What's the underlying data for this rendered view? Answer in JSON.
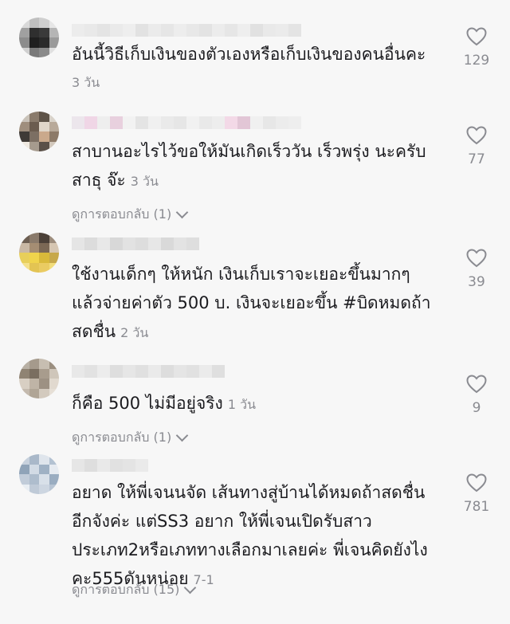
{
  "comments": [
    {
      "text": "อันนี้วิธีเก็บเงินของตัวเองหรือเก็บเงินของคนอื่นคะ",
      "time": "3 วัน",
      "likes": "129",
      "avatar_colors": [
        "#d9d9d9",
        "#bfbfbf",
        "#cfcfcf",
        "#e6e6e6",
        "#a0a0a0",
        "#2f2f2f",
        "#3a3a3a",
        "#b5b5b5",
        "#8c8c8c",
        "#1f1f1f",
        "#2a2a2a",
        "#9a9a9a",
        "#d0d0d0",
        "#7a7a7a",
        "#8a8a8a",
        "#e0e0e0"
      ],
      "username_colors": [
        "#ececec",
        "#e9e9e9",
        "#e4e4e4",
        "#eaeaea",
        "#eeeeee",
        "#e2e2e2",
        "#ebebeb",
        "#e6e6e6",
        "#ededed",
        "#e8e8e8",
        "#e3e3e3",
        "#ececec",
        "#e6e6e6",
        "#eeeeee",
        "#e1e1e1",
        "#e9e9e9",
        "#ebebeb",
        "#e4e4e4"
      ]
    },
    {
      "text": "สาบานอะไรไว้ขอให้มันเกิดเร็ววัน เร็วพรุ่ง นะครับ\nสาธุ จ๊ะ",
      "time": "3 วัน",
      "likes": "77",
      "replies_label": "ดูการตอบกลับ (1)",
      "avatar_colors": [
        "#c9c2b8",
        "#8a7b6c",
        "#5e5348",
        "#d8d2c9",
        "#9f8e7d",
        "#6b5c4f",
        "#e0d6c9",
        "#b8a999",
        "#3f3a36",
        "#7c6f63",
        "#caa98c",
        "#8d7a68",
        "#efe9e1",
        "#a69b8e",
        "#5a5048",
        "#d2c8bc"
      ],
      "username_colors": [
        "#ece6ec",
        "#f0d6e6",
        "#eeeeee",
        "#e8d0de",
        "#f2f2f2",
        "#e4e4e4",
        "#f0f0f0",
        "#eaeaea",
        "#e6e6e6",
        "#f1f1f1",
        "#e9e9e9",
        "#ededed",
        "#f3d9e7",
        "#e2c6d6",
        "#f0f0f0",
        "#e7e7e7",
        "#ececec",
        "#eeeeee"
      ]
    },
    {
      "text": "ใช้งานเด็กๆ ให้หนัก เงินเก็บเราจะเยอะขึ้นมากๆ\nแล้วจ่ายค่าตัว 500 บ. เงินจะเยอะขึ้น #บิดหมดถ้า\nสดชื่น",
      "time": "2 วัน",
      "likes": "39",
      "avatar_colors": [
        "#6d5f52",
        "#8a7a6b",
        "#4b4038",
        "#9c8c7c",
        "#c9b8a4",
        "#a58d73",
        "#7b6855",
        "#d6c6b2",
        "#e8cf5a",
        "#f0d44c",
        "#d9b93a",
        "#c7a84a",
        "#f4e08a",
        "#e3c453",
        "#eacb62",
        "#f2dd7a"
      ],
      "username_colors": [
        "#e5e5e5",
        "#dcdcdc",
        "#e8e8e8",
        "#d8d8d8",
        "#e2e2e2",
        "#dddddd",
        "#e7e7e7",
        "#d9d9d9",
        "#e3e3e3",
        "#dedede"
      ]
    },
    {
      "text": "ก็คือ 500 ไม่มีอยู่จริง",
      "time": "1 วัน",
      "likes": "9",
      "replies_label": "ดูการตอบกลับ (1)",
      "avatar_colors": [
        "#b8b0a4",
        "#a59a8c",
        "#c7beb1",
        "#9b8f80",
        "#8f8373",
        "#7a6e60",
        "#a89c8d",
        "#cfc6ba",
        "#d8cfc3",
        "#bfb4a6",
        "#9d9183",
        "#e1d9cf",
        "#c4baae",
        "#b0a596",
        "#d3cabe",
        "#e6dfd6"
      ],
      "username_colors": [
        "#e8e8e8",
        "#e2e2e2",
        "#ececec",
        "#dedede",
        "#e6e6e6",
        "#e0e0e0",
        "#eaeaea",
        "#dddddd",
        "#e5e5e5",
        "#e1e1e1",
        "#ebebeb",
        "#dfdfdf"
      ]
    },
    {
      "text": "อยาด ให้พี่เจนนจัด เส้นทางสู่บ้านได้หมดถ้าสดชื่น\nอีกจังค่ะ แต่SS3 อยาก ให้พี่เจนเปิดรับสาว\nประเภท2หรือเภททางเลือกมาเลยค่ะ พี่เจนคิดยังไง\nคะ555ดันหน่อย",
      "time": "7-1",
      "likes": "781",
      "replies_label": "ดูการตอบกลับ (15)",
      "avatar_colors": [
        "#c7d1dd",
        "#a9b8c9",
        "#dfe5ec",
        "#b3c2d2",
        "#8fa3b8",
        "#d2dbe5",
        "#9fb1c4",
        "#e6ebf1",
        "#c1ccd9",
        "#aebdcd",
        "#d8e0e9",
        "#9aadc1",
        "#e9eef3",
        "#bfcad7",
        "#cdd6e1",
        "#b7c4d3"
      ],
      "username_colors": [
        "#e6e6e6",
        "#dedede",
        "#e9e9e9",
        "#e1e1e1",
        "#e4e4e4",
        "#eaeaea"
      ]
    }
  ]
}
